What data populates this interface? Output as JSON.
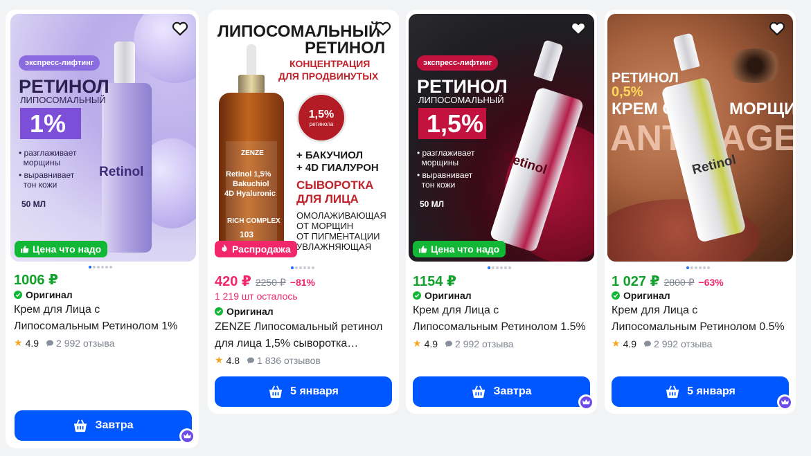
{
  "cards": [
    {
      "badge": "Цена что надо",
      "price": "1006 ₽",
      "original": "Оригинал",
      "title_line1": "Крем для Лица с",
      "title_line2": "Липосомальным Ретинолом 1%",
      "rating": "4.9",
      "reviews": "2 992 отзыва",
      "delivery": "Завтра",
      "image_text": {
        "chip": "экспресс-лифтинг",
        "heading": "РЕТИНОЛ",
        "sub": "ЛИПОСОМАЛЬНЫЙ",
        "percent": "1%",
        "bullet1a": "разглаживает",
        "bullet1b": "морщины",
        "bullet2a": "выравнивает",
        "bullet2b": "тон кожи",
        "volume": "50 МЛ",
        "brand": "Retinol"
      }
    },
    {
      "badge": "Распродажа",
      "price": "420 ₽",
      "old_price": "2250 ₽",
      "discount": "−81%",
      "stock": "1 219 шт осталось",
      "original": "Оригинал",
      "title_line1": "ZENZE Липосомальный ретинол",
      "title_line2": "для лица 1,5% сыворотка…",
      "rating": "4.8",
      "reviews": "1 836 отзывов",
      "delivery": "5 января",
      "image_text": {
        "h1": "ЛИПОСОМАЛЬНЫЙ",
        "h2": "РЕТИНОЛ",
        "c1": "КОНЦЕНТРАЦИЯ",
        "c2": "ДЛЯ ПРОДВИНУТЫХ",
        "circle1": "1,5%",
        "circle2": "ретинола",
        "p1": "+ БАКУЧИОЛ",
        "p2": "+ 4D ГИАЛУРОН",
        "s1": "СЫВОРОТКА",
        "s2": "ДЛЯ ЛИЦА",
        "d1": "ОМОЛАЖИВАЮЩАЯ",
        "d2": "ОТ МОРЩИН",
        "d3": "ОТ ПИГМЕНТАЦИИ",
        "d4": "УВЛАЖНЯЮЩАЯ",
        "bottle_brand": "ZENZE",
        "bottle1": "Retinol 1,5%",
        "bottle2": "Bakuchiol",
        "bottle3": "4D Hyaluronic",
        "bottle4": "RICH COMPLEX",
        "bottle5": "103"
      }
    },
    {
      "badge": "Цена что надо",
      "price": "1154 ₽",
      "original": "Оригинал",
      "title_line1": "Крем для Лица с",
      "title_line2": "Липосомальным Ретинолом 1.5%",
      "rating": "4.9",
      "reviews": "2 992 отзыва",
      "delivery": "Завтра",
      "image_text": {
        "chip": "экспресс-лифтинг",
        "heading": "РЕТИНОЛ",
        "sub": "ЛИПОСОМАЛЬНЫЙ",
        "percent": "1,5%",
        "bullet1a": "разглаживает",
        "bullet1b": "морщины",
        "bullet2a": "выравнивает",
        "bullet2b": "тон кожи",
        "volume": "50 МЛ",
        "brand": "Retinol"
      }
    },
    {
      "price": "1 027 ₽",
      "old_price": "2800 ₽",
      "discount": "−63%",
      "original": "Оригинал",
      "title_line1": "Крем для Лица с",
      "title_line2": "Липосомальным Ретинолом 0.5%",
      "rating": "4.9",
      "reviews": "2 992 отзыва",
      "delivery": "5 января",
      "image_text": {
        "l1": "РЕТИНОЛ",
        "l2": "0,5%",
        "l3a": "КРЕМ ОТ",
        "l3b": "МОРЩИН",
        "big_a": "ANTI",
        "big_b": "AGE",
        "brand": "Retinol"
      }
    }
  ],
  "colors": {
    "accent": "#0056ff",
    "price_green": "#11a12c",
    "sale_pink": "#f2266b",
    "badge_green": "#12b835",
    "star": "#f5a623",
    "crown": "#6c4ce8"
  },
  "icons": [
    "heart-icon",
    "thumbs-up-icon",
    "fire-icon",
    "check-circle-icon",
    "star-icon",
    "comment-icon",
    "basket-icon",
    "crown-icon"
  ]
}
